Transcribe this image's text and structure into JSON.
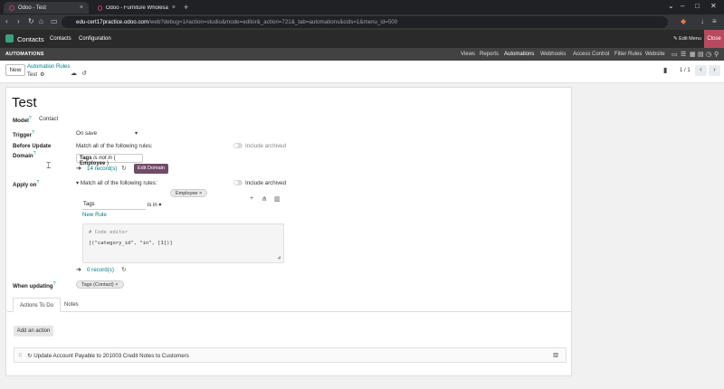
{
  "browser": {
    "tabs": [
      {
        "title": "Odoo - Test"
      },
      {
        "title": "Odoo - Furniture Wholesale Comp..."
      }
    ],
    "url_host": "edu-cert17practice.odoo.com",
    "url_path": "/web?debug=1#action=studio&mode=editor&_action=721&_tab=automations&cids=1&menu_id=500"
  },
  "odoo_nav": {
    "app_name": "Contacts",
    "menus": [
      "Contacts",
      "Configuration"
    ],
    "edit_menu": "Edit Menu",
    "close": "Close"
  },
  "studio": {
    "title": "AUTOMATIONS",
    "items": [
      "Views",
      "Reports",
      "Automations",
      "Webhooks",
      "Access Control",
      "Filter Rules",
      "Website"
    ]
  },
  "control_panel": {
    "new_label": "New",
    "breadcrumb_parent": "Automation Rules",
    "breadcrumb_current": "Test",
    "pager": "1 / 1"
  },
  "form": {
    "title": "Test",
    "model_label": "Model",
    "model_value": "Contact",
    "trigger_label": "Trigger",
    "trigger_value": "On save",
    "before_label_1": "Before Update",
    "before_label_2": "Domain",
    "before_match_text": "Match all of the following rules:",
    "include_archived": "Include archived",
    "before_domain": {
      "field": "Tags",
      "op": "is not in",
      "open": "(",
      "value": "Employee",
      "close": ")"
    },
    "before_records": "14 record(s)",
    "edit_domain": "Edit Domain",
    "apply_label": "Apply on",
    "apply_match_text": "Match all of the following rules:",
    "apply_chip": "Employee",
    "rule_field": "Tags",
    "rule_op": "is in",
    "new_rule": "New Rule",
    "code_comment": "# Code editor",
    "code_value": "[(\"category_id\", \"in\", [1])]",
    "apply_records": "0 record(s)",
    "when_updating_label": "When updating",
    "when_updating_chip": "Tags (Contact)",
    "tabs": [
      "Actions To Do",
      "Notes"
    ],
    "add_action": "Add an action",
    "action_text": "Update Account Payable to 201003 Credit Notes to Customers"
  }
}
